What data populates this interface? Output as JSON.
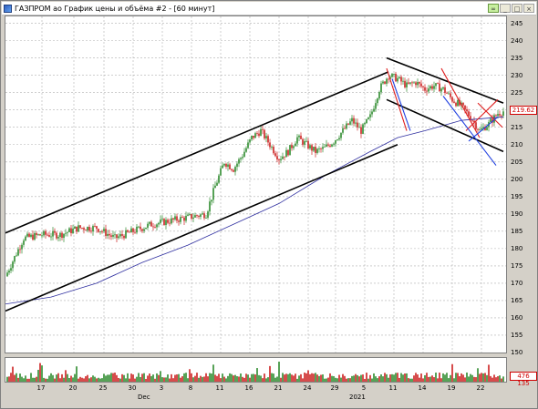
{
  "window": {
    "title": "ГАЗПРОМ ао График цены и объёма #2 - [60 минут]"
  },
  "toolbar": {
    "link_icon": "link-icon",
    "minimize_icon": "minimize-icon",
    "maximize_icon": "maximize-icon",
    "close_icon": "close-icon"
  },
  "axis": {
    "price_ticks": [
      "245",
      "240",
      "235",
      "230",
      "225",
      "220",
      "215",
      "210",
      "205",
      "200",
      "195",
      "190",
      "185",
      "180",
      "175",
      "170",
      "165",
      "160",
      "155",
      "150"
    ],
    "date_ticks": [
      "17",
      "20",
      "25",
      "30",
      "3",
      "8",
      "11",
      "16",
      "21",
      "24",
      "29",
      "5",
      "11",
      "14",
      "19",
      "22"
    ],
    "month_labels": [
      "Dec",
      "2021"
    ]
  },
  "badges": {
    "last_price": "219.62",
    "last_volume": "476 135"
  },
  "colors": {
    "up": "#2e8b2e",
    "down": "#cc2020",
    "ma": "#3030a0",
    "channel": "#000000",
    "trend_red": "#e02020",
    "trend_blue": "#2040e0",
    "grid": "#b0b0b0"
  },
  "chart_data": {
    "type": "candlestick",
    "title": "ГАЗПРОМ ао",
    "timeframe": "60 минут",
    "ylim": [
      150,
      247
    ],
    "price_approx": [
      [
        0,
        172
      ],
      [
        20,
        183
      ],
      [
        40,
        184
      ],
      [
        60,
        184
      ],
      [
        80,
        186
      ],
      [
        100,
        186
      ],
      [
        120,
        183
      ],
      [
        140,
        185
      ],
      [
        160,
        187
      ],
      [
        180,
        188
      ],
      [
        200,
        189
      ],
      [
        220,
        190
      ],
      [
        230,
        198
      ],
      [
        240,
        205
      ],
      [
        250,
        203
      ],
      [
        260,
        207
      ],
      [
        270,
        212
      ],
      [
        280,
        214
      ],
      [
        290,
        210
      ],
      [
        300,
        206
      ],
      [
        310,
        208
      ],
      [
        320,
        212
      ],
      [
        330,
        210
      ],
      [
        340,
        208
      ],
      [
        350,
        209
      ],
      [
        360,
        211
      ],
      [
        370,
        214
      ],
      [
        380,
        217
      ],
      [
        390,
        214
      ],
      [
        400,
        218
      ],
      [
        410,
        226
      ],
      [
        420,
        230
      ],
      [
        430,
        229
      ],
      [
        440,
        227
      ],
      [
        450,
        228
      ],
      [
        460,
        226
      ],
      [
        470,
        227
      ],
      [
        480,
        226
      ],
      [
        490,
        223
      ],
      [
        500,
        221
      ],
      [
        510,
        218
      ],
      [
        520,
        214
      ],
      [
        530,
        216
      ],
      [
        540,
        219
      ],
      [
        546,
        219.62
      ]
    ],
    "moving_average_approx": [
      [
        0,
        164
      ],
      [
        50,
        166
      ],
      [
        100,
        170
      ],
      [
        150,
        176
      ],
      [
        200,
        181
      ],
      [
        250,
        187
      ],
      [
        300,
        193
      ],
      [
        350,
        201
      ],
      [
        400,
        208
      ],
      [
        430,
        212
      ],
      [
        460,
        214
      ],
      [
        500,
        217
      ],
      [
        546,
        218
      ]
    ],
    "channel_lines": [
      {
        "from": [
          0,
          184.5
        ],
        "to": [
          420,
          231
        ]
      },
      {
        "from": [
          0,
          162
        ],
        "to": [
          430,
          210
        ]
      },
      {
        "from": [
          418,
          235
        ],
        "to": [
          546,
          222
        ]
      },
      {
        "from": [
          418,
          223
        ],
        "to": [
          546,
          208
        ]
      }
    ]
  }
}
